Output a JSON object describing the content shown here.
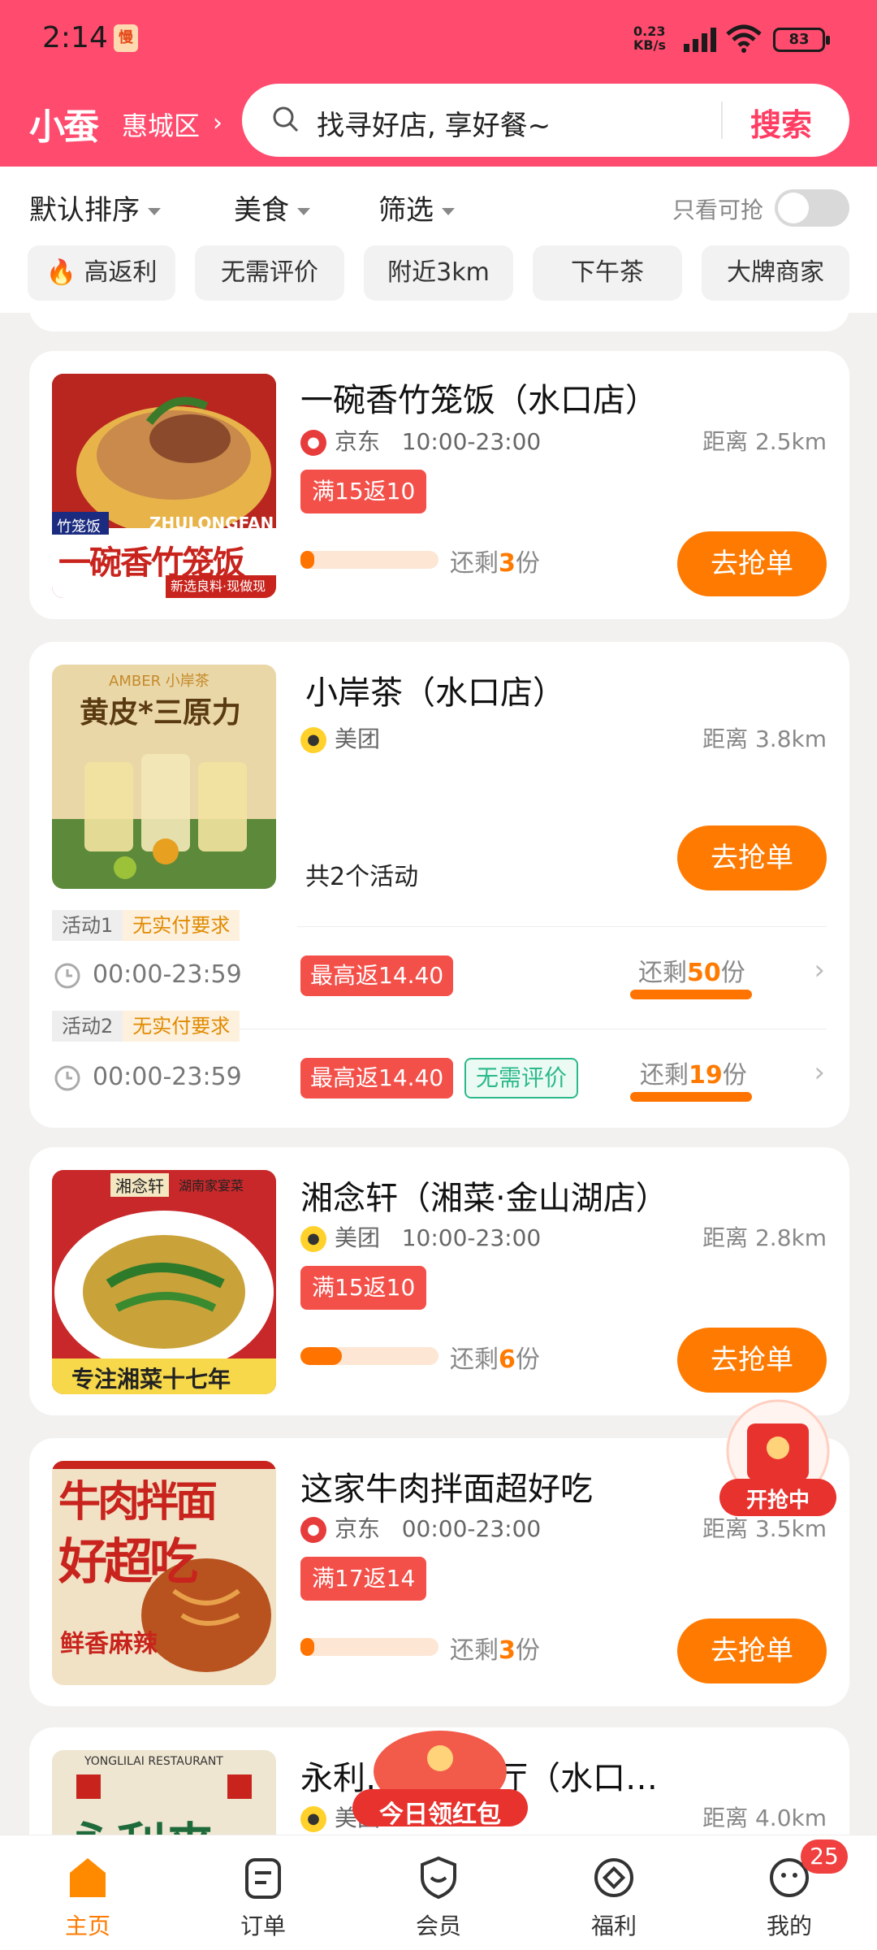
{
  "status_bar": {
    "time": "2:14",
    "net_speed_top": "0.23",
    "net_speed_bottom": "KB/s",
    "battery": "83"
  },
  "header": {
    "logo": "小蚕",
    "city": "惠城区",
    "search_placeholder": "找寻好店, 享好餐~",
    "search_button": "搜索"
  },
  "filters": {
    "sort": "默认排序",
    "food": "美食",
    "screen": "筛选",
    "only_available": "只看可抢",
    "chips": [
      "高返利",
      "无需评价",
      "附近3km",
      "下午茶",
      "大牌商家"
    ]
  },
  "cards": [
    {
      "name": "一碗香竹笼饭（水口店）",
      "platform": "京东",
      "hours": "10:00-23:00",
      "distance": "距离 2.5km",
      "tag": "满15返10",
      "remain_prefix": "还剩",
      "remain": "3",
      "remain_suffix": "份",
      "progress": 0.1,
      "button": "去抢单",
      "thumb": {
        "top": "竹笼饭",
        "brand": "ZHULONGFAN",
        "big": "一碗香竹笼饭",
        "sub": "新选良料·现做现卖"
      }
    },
    {
      "name": "小岸茶（水口店）",
      "platform": "美团",
      "distance": "距离 3.8km",
      "activity_count": "共2个活动",
      "button": "去抢单",
      "thumb": {
        "brand": "AMBER 小岸茶",
        "big": "黄皮*三原力"
      },
      "activities": [
        {
          "label": "活动1",
          "requirement": "无实付要求",
          "hours": "00:00-23:59",
          "tag": "最高返14.40",
          "remain_prefix": "还剩",
          "remain": "50",
          "remain_suffix": "份"
        },
        {
          "label": "活动2",
          "requirement": "无实付要求",
          "hours": "00:00-23:59",
          "tag": "最高返14.40",
          "tag2": "无需评价",
          "remain_prefix": "还剩",
          "remain": "19",
          "remain_suffix": "份"
        }
      ]
    },
    {
      "name": "湘念轩（湘菜·金山湖店）",
      "platform": "美团",
      "hours": "10:00-23:00",
      "distance": "距离 2.8km",
      "tag": "满15返10",
      "remain_prefix": "还剩",
      "remain": "6",
      "remain_suffix": "份",
      "progress": 0.3,
      "button": "去抢单",
      "thumb": {
        "brand": "湘念轩",
        "sub": "湖南家宴菜",
        "bottom": "专注湘菜十七年"
      }
    },
    {
      "name": "这家牛肉拌面超好吃",
      "platform": "京东",
      "hours": "00:00-23:00",
      "distance": "距离 3.5km",
      "tag": "满17返14",
      "remain_prefix": "还剩",
      "remain": "3",
      "remain_suffix": "份",
      "progress": 0.1,
      "button": "去抢单",
      "thumb": {
        "big1": "牛肉拌面",
        "big2": "好超吃",
        "sub": "鲜香麻辣"
      }
    },
    {
      "name": "永利…门茶餐厅（水口…",
      "platform": "美团",
      "distance": "距离 4.0km",
      "thumb": {
        "brand": "YONGLILAI RESTAURANT",
        "big": "永利来"
      }
    }
  ],
  "floats": {
    "grab_now": "开抢中",
    "daily_redpacket": "今日领红包"
  },
  "nav": {
    "items": [
      "主页",
      "订单",
      "会员",
      "福利",
      "我的"
    ],
    "badge": "25"
  },
  "colors": {
    "brand": "#ff4b6e",
    "accent": "#ff7a00",
    "tag_red": "#f4504a"
  }
}
